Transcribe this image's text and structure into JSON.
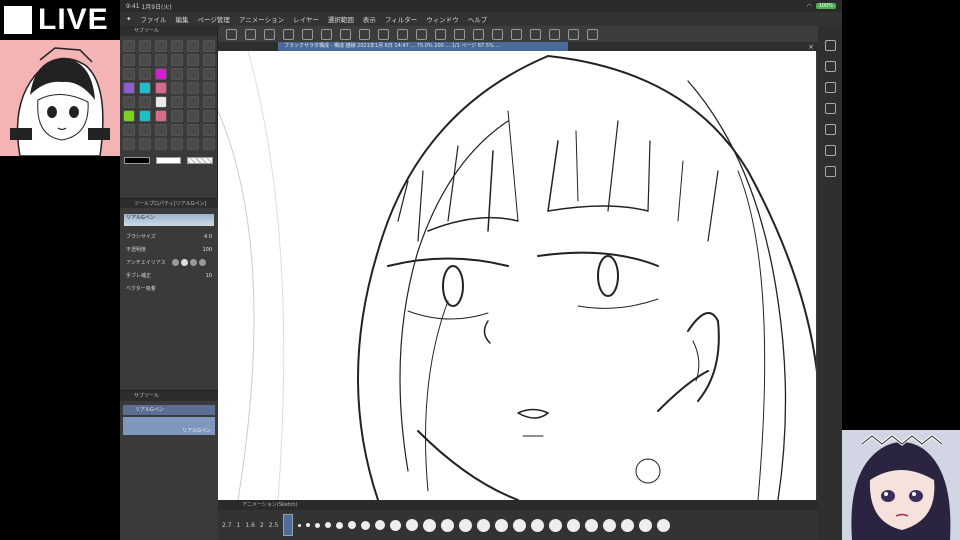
{
  "overlay": {
    "live_label": "LIVE"
  },
  "status": {
    "time": "9:41",
    "date": "1月9日(火)",
    "wifi_icon": "wifi-icon",
    "battery": "100%"
  },
  "menu": {
    "items": [
      "ファイル",
      "編集",
      "ページ管理",
      "アニメーション",
      "レイヤー",
      "選択範囲",
      "表示",
      "フィルター",
      "ウィンドウ",
      "ヘルプ"
    ]
  },
  "document": {
    "tab_title": "ブラックサラダ構成 - 構成 描線 2021年1月 6日 14:47 ... 75.0% 200 ... 1/1 ページ 67.5% ..."
  },
  "tool_palette": {
    "header": "サブツール",
    "color_accents": [
      "#d21fd2",
      "#8f5bd1",
      "#7bd11e",
      "#1ec0c7",
      "#d96a88"
    ]
  },
  "tool_property": {
    "header": "ツールプロパティ[リアルGペン]",
    "brush_name": "リアルGペン",
    "rows": [
      {
        "label": "ブラシサイズ",
        "value": "4.0"
      },
      {
        "label": "不透明度",
        "value": "100"
      },
      {
        "label": "アンチエイリアス",
        "value": ""
      },
      {
        "label": "手ブレ補正",
        "value": "10"
      },
      {
        "label": "ベクター吸着",
        "value": ""
      }
    ]
  },
  "subtool_panel": {
    "header": "サブツール",
    "item": "リアルGペン",
    "preview_label": "リアルGペン"
  },
  "timeline": {
    "header": "アニメーション(Sketch)",
    "numbers": [
      "2.7",
      "1",
      "1.6",
      "2",
      "2.5"
    ]
  }
}
